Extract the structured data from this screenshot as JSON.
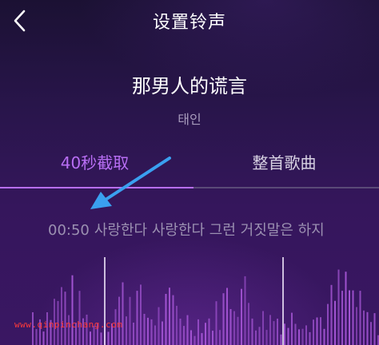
{
  "header": {
    "title": "设置铃声",
    "back_icon": "chevron-left-icon"
  },
  "song": {
    "title": "那男人的谎言",
    "artist": "태인"
  },
  "tabs": [
    {
      "label": "40秒截取",
      "active": true
    },
    {
      "label": "整首歌曲",
      "active": false
    }
  ],
  "lyric": {
    "time": "00:50",
    "text": "사랑한다 사랑한다 그런 거짓말은 하지"
  },
  "colors": {
    "accent": "#b86ef4",
    "arrow": "#3aa0f0",
    "watermark": "#ff3a3a"
  },
  "watermark": "www.qinpinchang.com"
}
